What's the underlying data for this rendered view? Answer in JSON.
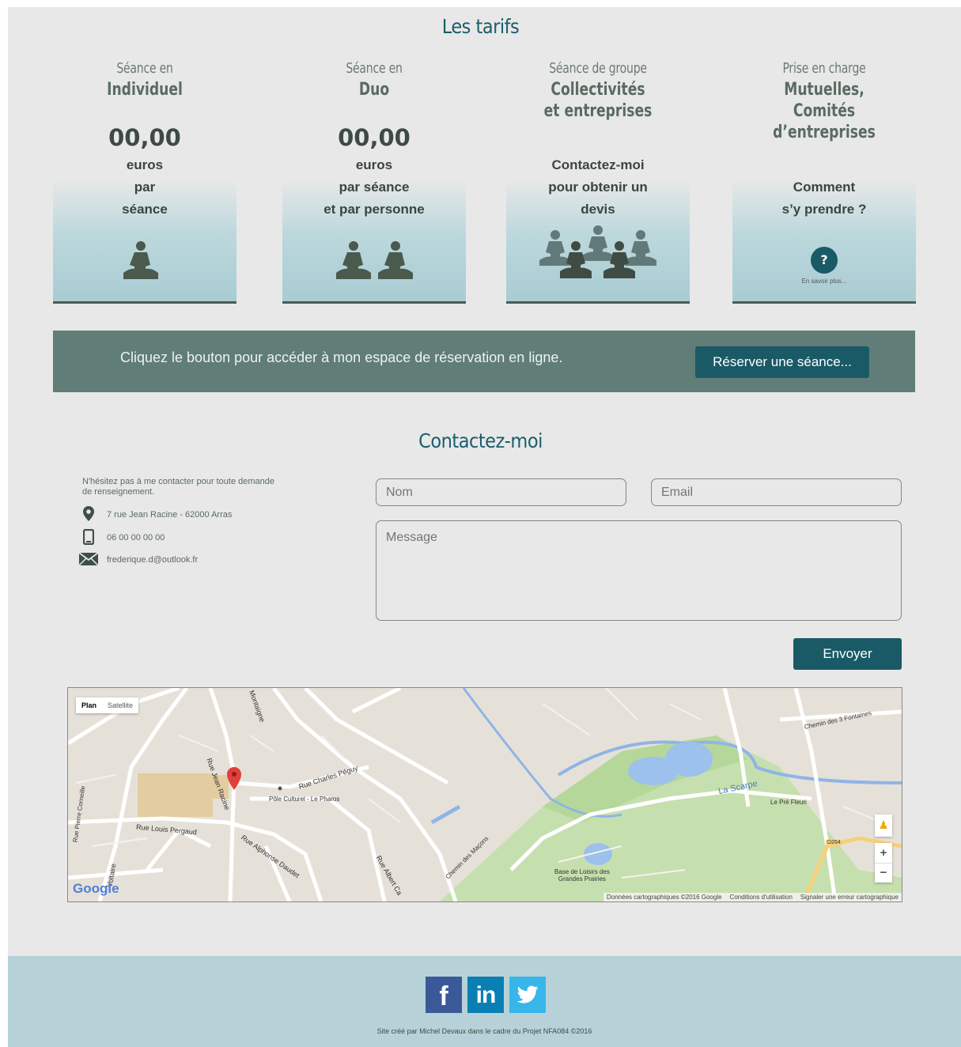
{
  "tarifs": {
    "title": "Les tarifs",
    "cards": [
      {
        "sup": "Séance en",
        "name_lines": [
          "Individuel"
        ],
        "price": "00,00",
        "text_lines": [
          "euros",
          "par",
          "séance"
        ]
      },
      {
        "sup": "Séance en",
        "name_lines": [
          "Duo"
        ],
        "price": "00,00",
        "text_lines": [
          "euros",
          "par séance",
          "et par personne"
        ]
      },
      {
        "sup": "Séance de groupe",
        "name_lines": [
          "Collectivités",
          "et entreprises"
        ],
        "price": "",
        "text_lines": [
          "Contactez-moi",
          "pour obtenir un",
          "devis"
        ]
      },
      {
        "sup": "Prise en charge",
        "name_lines": [
          "Mutuelles,",
          "Comités",
          "d’entreprises"
        ],
        "price": "",
        "text_lines": [
          "Comment",
          "s’y prendre ?"
        ],
        "help_label": "?",
        "more_link": "En savoir plus..."
      }
    ]
  },
  "banner": {
    "text": "Cliquez le bouton pour accéder à mon espace de réservation en ligne.",
    "button": "Réserver une séance..."
  },
  "contact": {
    "title": "Contactez-moi",
    "intro_lines": [
      "N'hésitez pas à me contacter pour toute demande",
      "de renseignement."
    ],
    "address": "7 rue Jean Racine - 62000 Arras",
    "phone": "06 00 00 00 00",
    "email": "frederique.d@outlook.fr",
    "form": {
      "name_placeholder": "Nom",
      "email_placeholder": "Email",
      "message_placeholder": "Message",
      "submit": "Envoyer"
    }
  },
  "map": {
    "tab_plan": "Plan",
    "tab_satellite": "Satellite",
    "labels": {
      "montaigne": "Montaigne",
      "jean_racine": "Rue Jean Racine",
      "charles_peguy": "Rue Charles Péguy",
      "pole": "Pôle Culturel - Le Pharos",
      "corneille": "Rue Pierre Corneille",
      "pergaud": "Rue Louis Pergaud",
      "daudet": "Rue Alphonse Daudet",
      "albert": "Rue Albert Ca",
      "voltaire": "Voltaire",
      "macons": "Chemin des Maçons",
      "scarpe": "La Scarpe",
      "fontaines": "Chemin des 3 Fontaines",
      "pre_fleuri": "Le Pré Fleuri",
      "d264": "D264",
      "base_loisirs_1": "Base de Loisirs des",
      "base_loisirs_2": "Grandes Prairies"
    },
    "zoom_in": "+",
    "zoom_out": "−",
    "logo": "Google",
    "attribution": "Données cartographiques ©2016 Google",
    "terms": "Conditions d'utilisation",
    "report": "Signaler une erreur cartographique"
  },
  "footer": {
    "social": [
      {
        "name": "facebook",
        "glyph": "f",
        "color": "#3b5998"
      },
      {
        "name": "linkedin",
        "glyph": "in",
        "color": "#0a7fb4"
      },
      {
        "name": "twitter",
        "glyph": "🐦",
        "color": "#38b6ea"
      }
    ],
    "credit": "Site créé par Michel Devaux dans le cadre du Projet NFA084 ©2016"
  },
  "colors": {
    "accent": "#1a5e6b",
    "banner": "#607d77",
    "footer": "#b6d2d8",
    "page": "#e8e8e8"
  }
}
